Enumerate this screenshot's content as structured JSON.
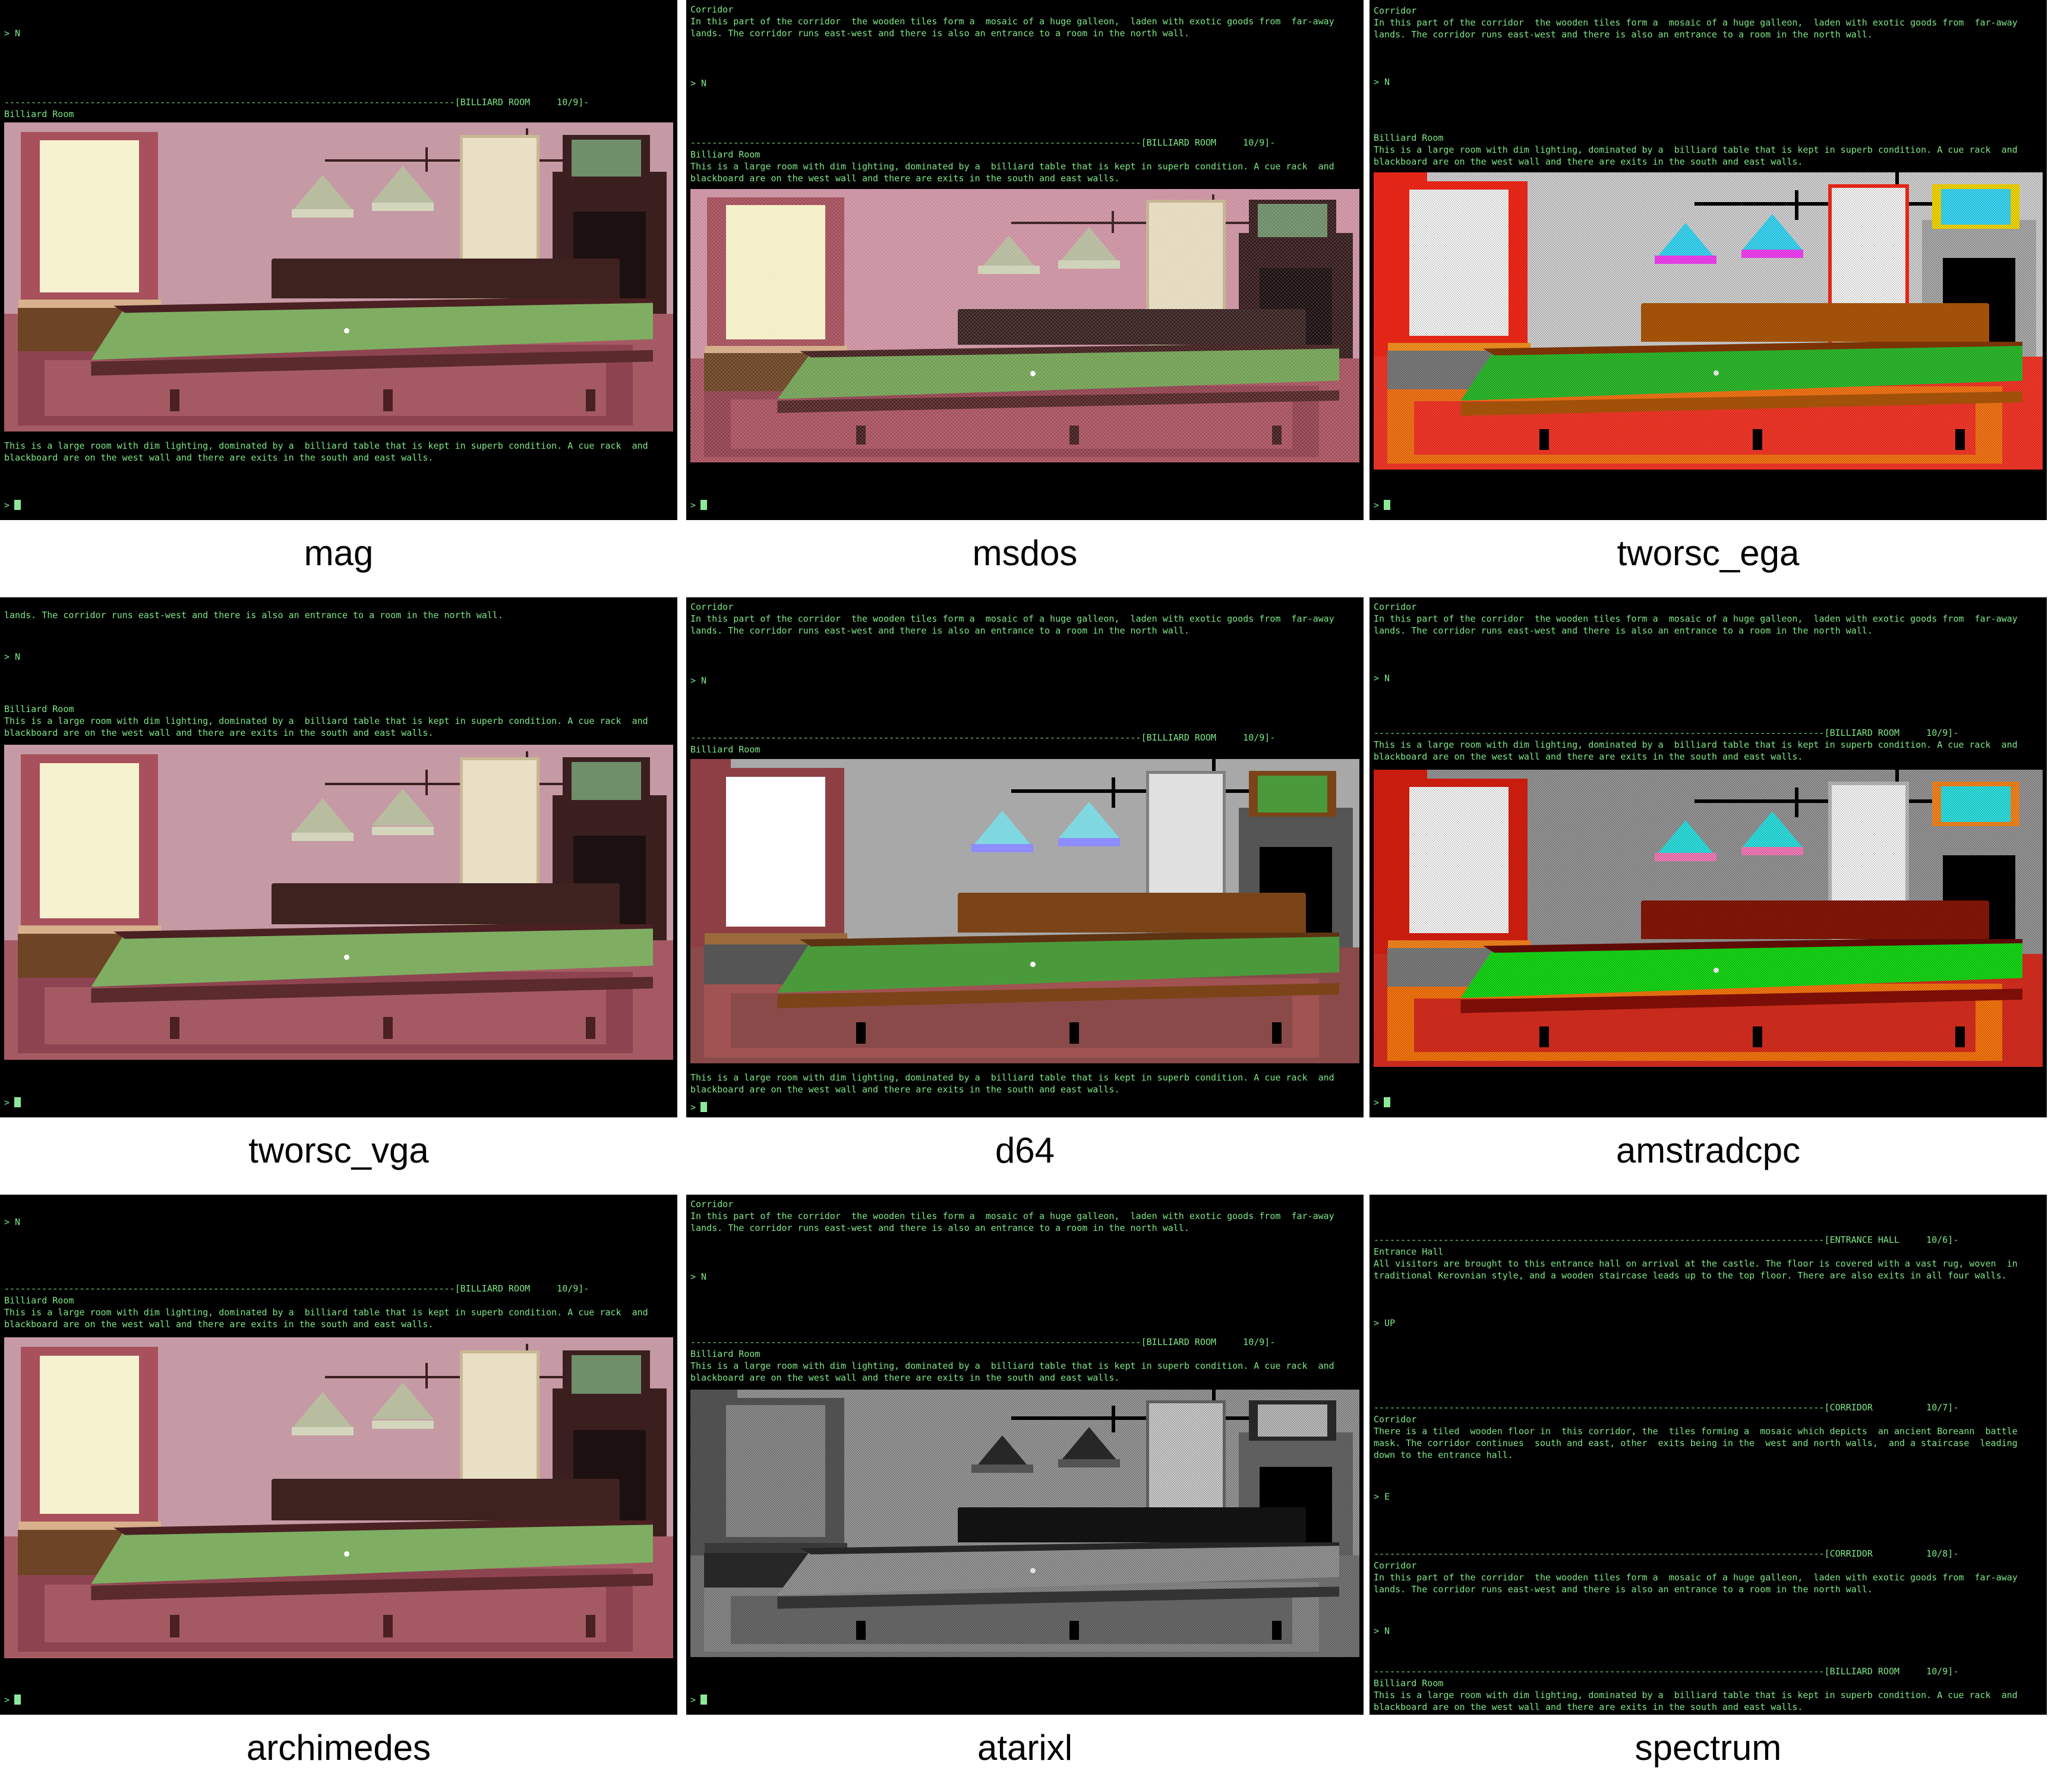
{
  "meta": {
    "grid_rows": 3,
    "grid_cols": 3,
    "caption_color": "#000000",
    "terminal_background": "#000000",
    "terminal_text_color": "#7ee787",
    "cursor_color": "#8ce99a"
  },
  "strings": {
    "corridor_title": "Corridor",
    "corridor_line1": "In this part of the corridor  the wooden tiles form a  mosaic of a huge galleon,  laden with exotic goods from  far-away",
    "corridor_line2": "lands. The corridor runs east-west and there is also an entrance to a room in the north wall.",
    "corridor_line2_only": "lands. The corridor runs east-west and there is also an entrance to a room in the north wall.",
    "billiard_title": "Billiard Room",
    "billiard_line1": "This is a large room with dim lighting, dominated by a  billiard table that is kept in superb condition. A cue rack  and",
    "billiard_line2": "blackboard are on the west wall and there are exits in the south and east walls.",
    "entrance_title": "Entrance Hall",
    "entrance_line1": "All visitors are brought to this entrance hall on arrival at the castle. The floor is covered with a vast rug, woven  in",
    "entrance_line2": "traditional Kerovnian style, and a wooden staircase leads up to the top floor. There are also exits in all four walls.",
    "corridor2_title": "Corridor",
    "corridor2_line1": "There is a tiled  wooden floor in  this corridor, the  tiles forming a  mosaic which depicts  an ancient Boreann  battle",
    "corridor2_line2": "mask. The corridor continues  south and east, other  exits being in the  west and north walls,  and a staircase  leading",
    "corridor2_line3": "down to the entrance hall.",
    "prompt_n": "> N",
    "prompt_up": "> UP",
    "prompt_e": "> E",
    "prompt_bare": ">",
    "statusbar_billiard": "------------------------------------------------------------------------------------[BILLIARD ROOM     10/9]-",
    "statusbar_entrance": "------------------------------------------------------------------------------------[ENTRANCE HALL     10/6]-",
    "statusbar_corridor7": "------------------------------------------------------------------------------------[CORRIDOR          10/7]-",
    "statusbar_corridor8": "------------------------------------------------------------------------------------[CORRIDOR          10/8]-"
  },
  "status_fields": {
    "billiard_room_name": "BILLIARD ROOM",
    "billiard_room_score": "10/9",
    "entrance_hall_name": "ENTRANCE HALL",
    "entrance_hall_score": "10/6",
    "corridor_name": "CORRIDOR",
    "corridor_score_7": "10/7",
    "corridor_score_8": "10/8"
  },
  "panels": [
    {
      "id": "mag",
      "caption": "mag",
      "row": 1,
      "col": 1,
      "has_picture": true,
      "picture_style": "mag",
      "palette": {
        "wall": "#c59aa4",
        "floor": "#a55a63",
        "rug": "#8e4450",
        "felt": "#7fae63",
        "wood": "#5a2a2c",
        "window_glass": "#f6f2cf",
        "curtain": "#a8515c",
        "lamp": "#b9bda0",
        "frame": "#3b1f1f",
        "sofa": "#3d2220",
        "sill": "#d8b08c"
      }
    },
    {
      "id": "msdos",
      "caption": "msdos",
      "row": 1,
      "col": 2,
      "has_picture": true,
      "picture_style": "msdos",
      "palette": {
        "wall": "#c98f9e",
        "floor": "#a44f5c",
        "rug": "#8f3f4d",
        "felt": "#6f9e52",
        "wood": "#4f2423",
        "window_glass": "#f3eec5",
        "curtain": "#a14c57",
        "lamp": "#b4b89b",
        "frame": "#33191a",
        "sofa": "#35201e",
        "sill": "#d3a984"
      }
    },
    {
      "id": "tworsc_ega",
      "caption": "tworsc_ega",
      "row": 1,
      "col": 3,
      "has_picture": true,
      "picture_style": "ega",
      "palette": {
        "wall": "#d8d8d8",
        "floor": "#ff3a2a",
        "rug": "#ff7a18",
        "felt": "#2fc22f",
        "wood": "#b55b0a",
        "window_glass": "#ffffff",
        "curtain": "#ff2a1a",
        "lamp": "#3ee0ff",
        "frame": "#000000",
        "sofa": "#c05a10",
        "sill": "#ff9a22"
      }
    },
    {
      "id": "tworsc_vga",
      "caption": "tworsc_vga",
      "row": 2,
      "col": 1,
      "has_picture": true,
      "picture_style": "mag",
      "palette": {
        "wall": "#c59aa4",
        "floor": "#a55a63",
        "rug": "#8e4450",
        "felt": "#7fae63",
        "wood": "#5a2a2c",
        "window_glass": "#f6f2cf",
        "curtain": "#a8515c",
        "lamp": "#b9bda0",
        "frame": "#3b1f1f",
        "sofa": "#3d2220",
        "sill": "#d8b08c"
      }
    },
    {
      "id": "d64",
      "caption": "d64",
      "row": 2,
      "col": 2,
      "has_picture": true,
      "picture_style": "d64",
      "palette": {
        "wall": "#a8a8a8",
        "floor": "#8b4a4a",
        "rug": "#a15252",
        "felt": "#4a9a3c",
        "wood": "#7a4418",
        "window_glass": "#ffffff",
        "curtain": "#8e3f44",
        "lamp": "#7fd8e0",
        "frame": "#000000",
        "sofa": "#6b3d16",
        "sill": "#9a6a3a"
      }
    },
    {
      "id": "amstradcpc",
      "caption": "amstradcpc",
      "row": 2,
      "col": 3,
      "has_picture": true,
      "picture_style": "cpc",
      "palette": {
        "wall": "#9a9a9a",
        "floor": "#e03020",
        "rug": "#ff7a10",
        "felt": "#18e018",
        "wood": "#8a1008",
        "window_glass": "#ffffff",
        "curtain": "#e02010",
        "lamp": "#30e8e8",
        "frame": "#000000",
        "sofa": "#8a1808",
        "sill": "#ff8a20"
      }
    },
    {
      "id": "archimedes",
      "caption": "archimedes",
      "row": 3,
      "col": 1,
      "has_picture": true,
      "picture_style": "mag",
      "palette": {
        "wall": "#c59aa4",
        "floor": "#a55a63",
        "rug": "#8e4450",
        "felt": "#7fae63",
        "wood": "#5a2a2c",
        "window_glass": "#f6f2cf",
        "curtain": "#a8515c",
        "lamp": "#b9bda0",
        "frame": "#3b1f1f",
        "sofa": "#3d2220",
        "sill": "#d8b08c"
      }
    },
    {
      "id": "atarixl",
      "caption": "atarixl",
      "row": 3,
      "col": 2,
      "has_picture": true,
      "picture_style": "mono",
      "palette": {
        "wall": "#9b9b9b",
        "floor": "#7a7a7a",
        "rug": "#8e8e8e",
        "felt": "#9a9a9a",
        "wood": "#3a3a3a",
        "window_glass": "#8f8f8f",
        "curtain": "#5a5a5a",
        "lamp": "#2c2c2c",
        "frame": "#000000",
        "sofa": "#141414",
        "sill": "#404040"
      }
    },
    {
      "id": "spectrum",
      "caption": "spectrum",
      "row": 3,
      "col": 3,
      "has_picture": false,
      "picture_style": "none",
      "palette": {}
    }
  ]
}
